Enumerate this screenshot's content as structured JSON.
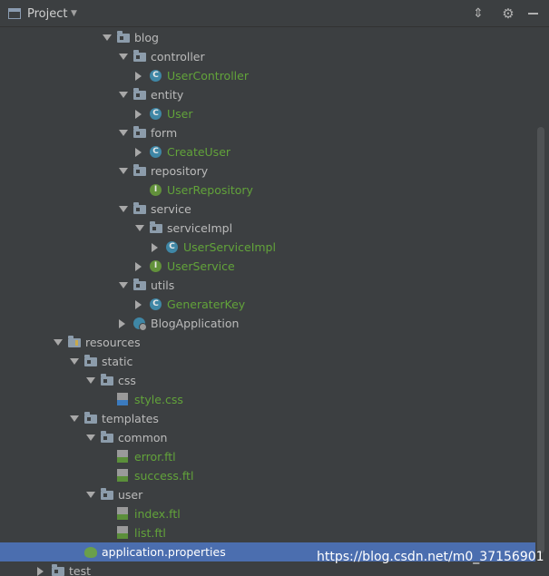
{
  "header": {
    "title": "Project",
    "dropdown_icon": "triangle-down",
    "collapse_icon": "collapse-all",
    "settings_icon": "gear",
    "hide_icon": "minimize"
  },
  "colors": {
    "background": "#3c3f41",
    "selection": "#4b6eaf",
    "source_text": "#62a33a",
    "class_icon": "#3f87a6",
    "interface_icon": "#62913b"
  },
  "tree": [
    {
      "label": "blog",
      "depth": 0,
      "expand": "open",
      "icon": "folder",
      "kind": "folder"
    },
    {
      "label": "controller",
      "depth": 1,
      "expand": "open",
      "icon": "folder",
      "kind": "folder"
    },
    {
      "label": "UserController",
      "depth": 2,
      "expand": "closed",
      "icon": "class",
      "kind": "source"
    },
    {
      "label": "entity",
      "depth": 1,
      "expand": "open",
      "icon": "folder",
      "kind": "folder"
    },
    {
      "label": "User",
      "depth": 2,
      "expand": "closed",
      "icon": "class",
      "kind": "source"
    },
    {
      "label": "form",
      "depth": 1,
      "expand": "open",
      "icon": "folder",
      "kind": "folder"
    },
    {
      "label": "CreateUser",
      "depth": 2,
      "expand": "closed",
      "icon": "class",
      "kind": "source"
    },
    {
      "label": "repository",
      "depth": 1,
      "expand": "open",
      "icon": "folder",
      "kind": "folder"
    },
    {
      "label": "UserRepository",
      "depth": 2,
      "expand": "none",
      "icon": "interface",
      "kind": "source"
    },
    {
      "label": "service",
      "depth": 1,
      "expand": "open",
      "icon": "folder",
      "kind": "folder"
    },
    {
      "label": "serviceImpl",
      "depth": 2,
      "expand": "open",
      "icon": "folder",
      "kind": "folder"
    },
    {
      "label": "UserServiceImpl",
      "depth": 3,
      "expand": "closed",
      "icon": "class",
      "kind": "source"
    },
    {
      "label": "UserService",
      "depth": 2,
      "expand": "closed",
      "icon": "interface",
      "kind": "source"
    },
    {
      "label": "utils",
      "depth": 1,
      "expand": "open",
      "icon": "folder",
      "kind": "folder"
    },
    {
      "label": "GeneraterKey",
      "depth": 2,
      "expand": "closed",
      "icon": "class",
      "kind": "source"
    },
    {
      "label": "BlogApplication",
      "depth": 1,
      "expand": "closed",
      "icon": "spring-boot-class",
      "kind": "plain"
    },
    {
      "label": "resources",
      "depth": -3,
      "expand": "open",
      "icon": "resources-folder",
      "kind": "folder"
    },
    {
      "label": "static",
      "depth": -2,
      "expand": "open",
      "icon": "folder",
      "kind": "folder"
    },
    {
      "label": "css",
      "depth": -1,
      "expand": "open",
      "icon": "folder",
      "kind": "folder"
    },
    {
      "label": "style.css",
      "depth": 0,
      "expand": "none",
      "icon": "css-file",
      "kind": "source"
    },
    {
      "label": "templates",
      "depth": -2,
      "expand": "open",
      "icon": "folder",
      "kind": "folder"
    },
    {
      "label": "common",
      "depth": -1,
      "expand": "open",
      "icon": "folder",
      "kind": "folder"
    },
    {
      "label": "error.ftl",
      "depth": 0,
      "expand": "none",
      "icon": "ftl-file",
      "kind": "source"
    },
    {
      "label": "success.ftl",
      "depth": 0,
      "expand": "none",
      "icon": "ftl-file",
      "kind": "source"
    },
    {
      "label": "user",
      "depth": -1,
      "expand": "open",
      "icon": "folder",
      "kind": "folder"
    },
    {
      "label": "index.ftl",
      "depth": 0,
      "expand": "none",
      "icon": "ftl-file",
      "kind": "source"
    },
    {
      "label": "list.ftl",
      "depth": 0,
      "expand": "none",
      "icon": "ftl-file",
      "kind": "source"
    },
    {
      "label": "application.properties",
      "depth": -2,
      "expand": "none",
      "icon": "properties-file",
      "kind": "source",
      "selected": true
    },
    {
      "label": "test",
      "depth": -4,
      "expand": "closed",
      "icon": "folder",
      "kind": "folder"
    }
  ],
  "watermark": "https://blog.csdn.net/m0_37156901"
}
